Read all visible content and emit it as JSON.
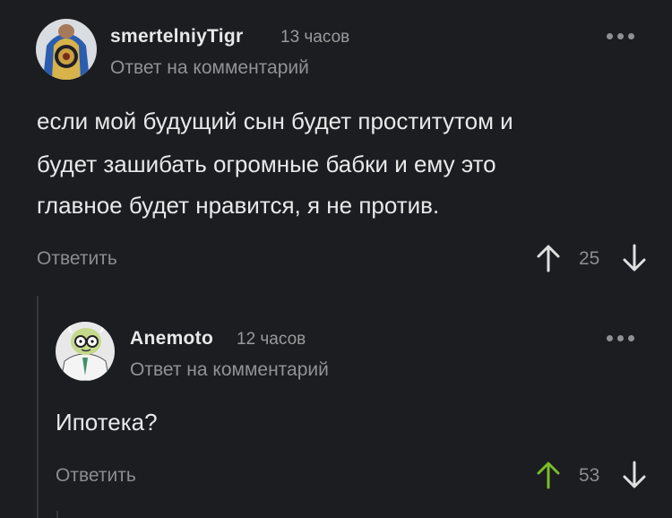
{
  "colors": {
    "background": "#1b1d20",
    "upvote_active": "#7cbb2b",
    "upvote_inactive": "#e0e0e0"
  },
  "comments": [
    {
      "username": "smertelniyTigr",
      "time": "13 часов",
      "reply_to": "Ответ на комментарий",
      "text_lines": [
        "если мой будущий сын будет проститутом и",
        "будет зашибать огромные бабки и ему это",
        "главное будет нравится, я не против."
      ],
      "reply_label": "Ответить",
      "rating": "25",
      "upvoted": false,
      "avatar_icon": "avatar-ornate-shirt-icon"
    },
    {
      "username": "Anemoto",
      "time": "12 часов",
      "reply_to": "Ответ на комментарий",
      "text_lines": [
        "Ипотека?"
      ],
      "reply_label": "Ответить",
      "rating": "53",
      "upvoted": true,
      "avatar_icon": "avatar-professor-cartoon-icon"
    }
  ]
}
